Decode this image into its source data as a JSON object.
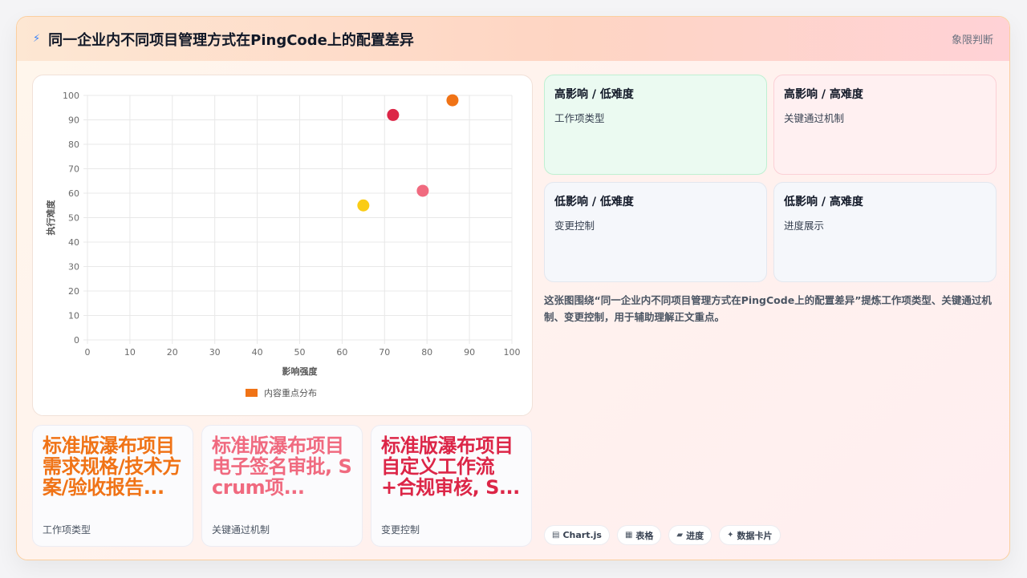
{
  "header": {
    "title": "同一企业内不同项目管理方式在PingCode上的配置差异",
    "tag": "象限判断"
  },
  "chart_data": {
    "type": "scatter",
    "xlabel": "影响强度",
    "ylabel": "执行难度",
    "xlim": [
      0,
      100
    ],
    "ylim": [
      0,
      100
    ],
    "x_ticks": [
      "0",
      "10",
      "20",
      "30",
      "40",
      "50",
      "60",
      "70",
      "80",
      "90",
      "100"
    ],
    "y_ticks": [
      "100",
      "90",
      "80",
      "70",
      "60",
      "50",
      "40",
      "30",
      "20",
      "10",
      "0"
    ],
    "grid": true,
    "legend_position": "bottom",
    "legend_label": "内容重点分布",
    "legend_color": "#f07316",
    "points": [
      {
        "x": 65,
        "y": 55,
        "color": "#facc15"
      },
      {
        "x": 72,
        "y": 92,
        "color": "#dc2647"
      },
      {
        "x": 79,
        "y": 61,
        "color": "#f06a7f"
      },
      {
        "x": 86,
        "y": 98,
        "color": "#f07316"
      }
    ]
  },
  "stats": [
    {
      "text": "标准版瀑布项目 需求规格/技术方案/验收报告...",
      "label": "工作项类型",
      "color": "#f07316"
    },
    {
      "text": "标准版瀑布项目 电子签名审批, Scrum项...",
      "label": "关键通过机制",
      "color": "#f06a7f"
    },
    {
      "text": "标准版瀑布项目 自定义工作流+合规审核, S...",
      "label": "变更控制",
      "color": "#dc2647"
    }
  ],
  "quadrants": [
    {
      "title": "高影响 / 低难度",
      "item": "工作项类型"
    },
    {
      "title": "高影响 / 高难度",
      "item": "关键通过机制"
    },
    {
      "title": "低影响 / 低难度",
      "item": "变更控制"
    },
    {
      "title": "低影响 / 高难度",
      "item": "进度展示"
    }
  ],
  "description": "这张图围绕“同一企业内不同项目管理方式在PingCode上的配置差异”提炼工作项类型、关键通过机制、变更控制，用于辅助理解正文重点。",
  "pills": [
    {
      "icon": "▤",
      "label": "Chart.js"
    },
    {
      "icon": "▦",
      "label": "表格"
    },
    {
      "icon": "▰",
      "label": "进度"
    },
    {
      "icon": "✦",
      "label": "数据卡片"
    }
  ]
}
